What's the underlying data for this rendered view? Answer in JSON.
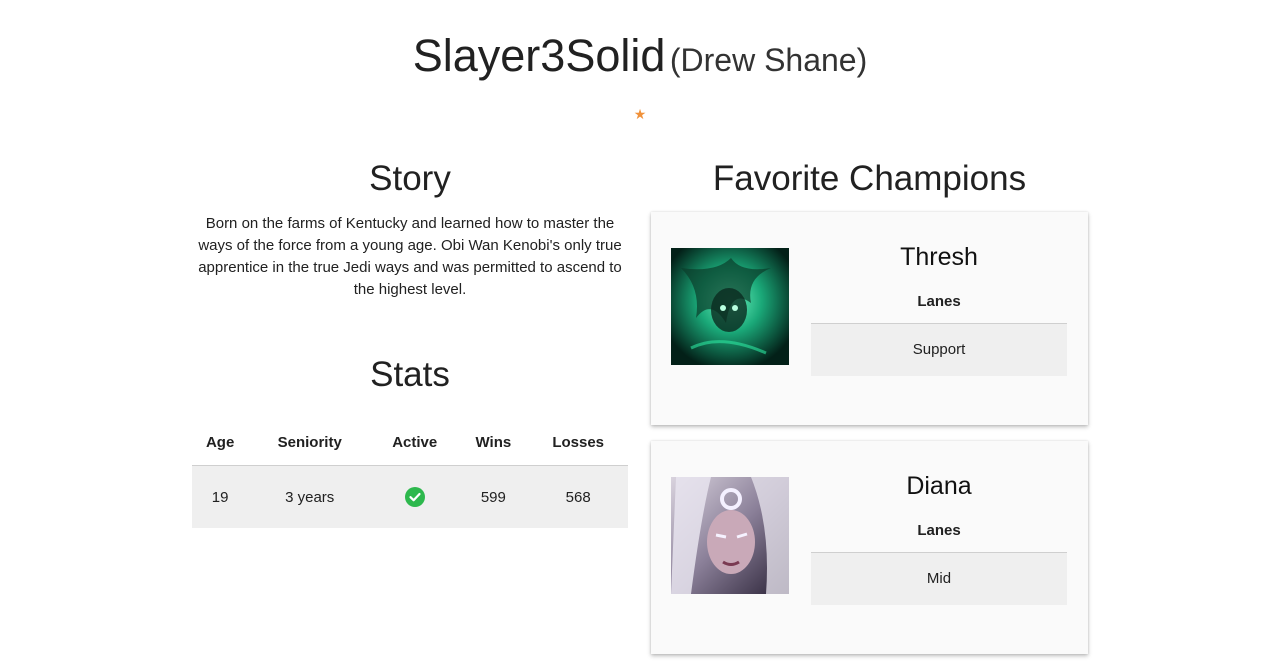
{
  "header": {
    "username": "Slayer3Solid",
    "real_name": "(Drew Shane)",
    "rating_icon": "star-icon",
    "rating_color": "#f0913a"
  },
  "story": {
    "title": "Story",
    "text": "Born on the farms of Kentucky and learned how to master the ways of the force from a young age. Obi Wan Kenobi's only true apprentice in the true Jedi ways and was permitted to ascend to the highest level."
  },
  "stats": {
    "title": "Stats",
    "columns": [
      "Age",
      "Seniority",
      "Active",
      "Wins",
      "Losses"
    ],
    "row": {
      "age": "19",
      "seniority": "3 years",
      "active_icon": "check-circle-icon",
      "active_color": "#2db84d",
      "wins": "599",
      "losses": "568"
    }
  },
  "champions": {
    "title": "Favorite Champions",
    "items": [
      {
        "name": "Thresh",
        "lanes_label": "Lanes",
        "lane": "Support",
        "portrait": "thresh-portrait"
      },
      {
        "name": "Diana",
        "lanes_label": "Lanes",
        "lane": "Mid",
        "portrait": "diana-portrait"
      }
    ]
  }
}
